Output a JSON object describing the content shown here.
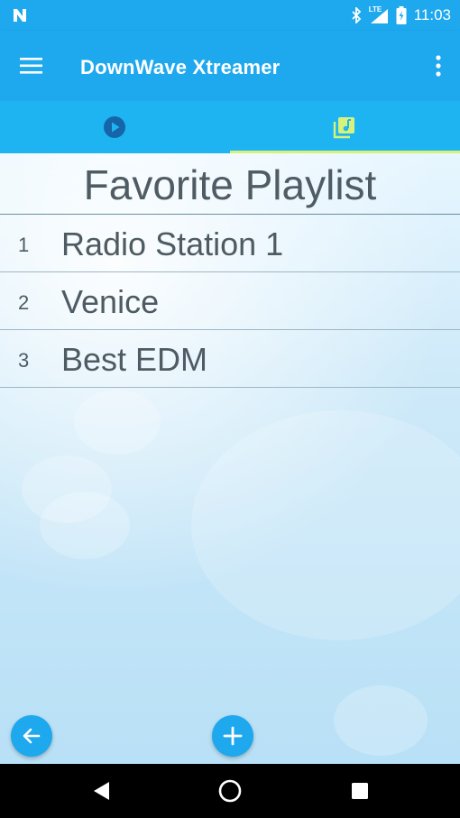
{
  "status_bar": {
    "time": "11:03",
    "network_label": "LTE",
    "icons": [
      "notification-n-icon",
      "bluetooth-icon",
      "lte-signal-icon",
      "battery-charging-icon"
    ]
  },
  "app_bar": {
    "title": "DownWave Xtreamer",
    "icons": [
      "hamburger-menu-icon",
      "overflow-menu-icon"
    ]
  },
  "tabs": [
    {
      "icon": "play-circle-icon",
      "selected": false
    },
    {
      "icon": "music-library-icon",
      "selected": true
    }
  ],
  "playlist": {
    "title": "Favorite Playlist",
    "items": [
      {
        "number": "1",
        "name": "Radio Station 1"
      },
      {
        "number": "2",
        "name": "Venice"
      },
      {
        "number": "3",
        "name": "Best EDM"
      }
    ]
  },
  "actions": {
    "back_icon": "arrow-left-icon",
    "add_icon": "plus-icon"
  },
  "nav_bar": {
    "icons": [
      "back-triangle-icon",
      "home-circle-icon",
      "recents-square-icon"
    ]
  },
  "colors": {
    "primary": "#1ea8ee",
    "tab_bar": "#1eb4f1",
    "tab_indicator": "#d7f27a",
    "text": "#4e5b62",
    "tab_icon_inactive": "#1565a8"
  }
}
